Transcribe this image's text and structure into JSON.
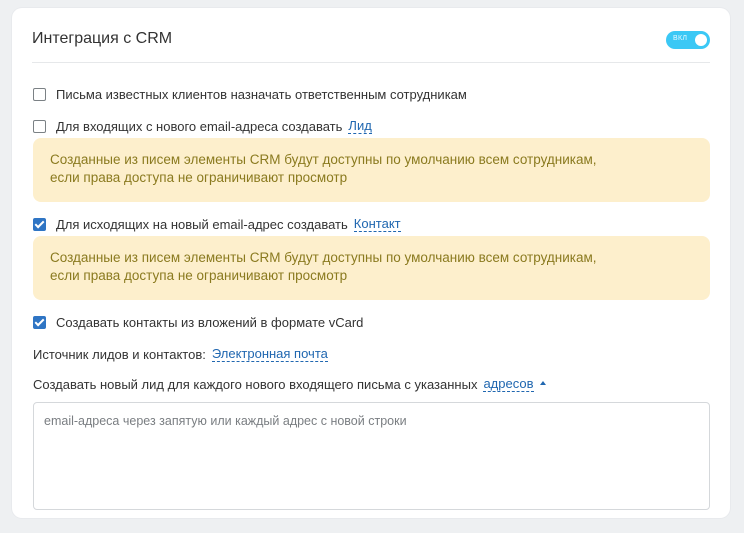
{
  "section": {
    "title": "Интеграция с CRM",
    "toggle_label": "ВКЛ",
    "toggle_state": "on",
    "accent_color": "#3bc8f5"
  },
  "options": [
    {
      "label": "Письма известных клиентов назначать ответственным сотрудникам",
      "checked": false
    },
    {
      "label": "Для входящих с нового email-адреса создавать",
      "checked": false,
      "link": "Лид"
    },
    {
      "label": "Для исходящих на новый email-адрес создавать",
      "checked": true,
      "link": "Контакт"
    },
    {
      "label": "Создавать контакты из вложений в формате vCard",
      "checked": true
    }
  ],
  "notice": {
    "line1": "Созданные из писем элементы CRM будут доступны по умолчанию всем сотрудникам,",
    "line2": "если права доступа не ограничивают просмотр"
  },
  "source": {
    "label": "Источник лидов и контактов:",
    "value": "Электронная почта"
  },
  "new_lead": {
    "label": "Создавать новый лид для каждого нового входящего письма с указанных",
    "link": "адресов",
    "placeholder": "email-адреса через запятую или каждый адрес с новой строки"
  }
}
